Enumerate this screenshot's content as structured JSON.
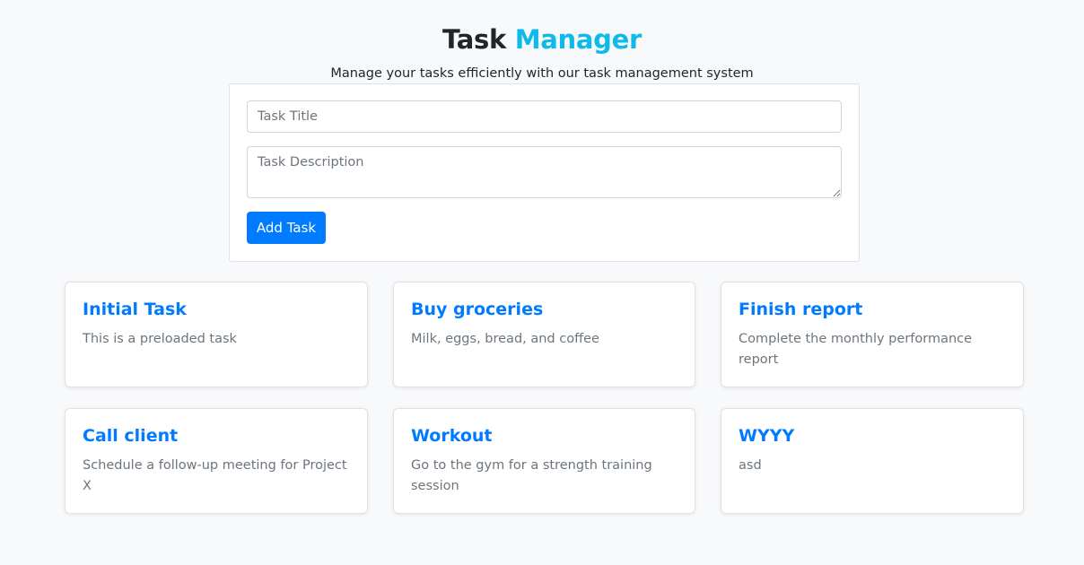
{
  "header": {
    "title_part1": "Task",
    "title_part2": "Manager",
    "subtitle": "Manage your tasks efficiently with our task management system"
  },
  "form": {
    "title_placeholder": "Task Title",
    "description_placeholder": "Task Description",
    "add_button_label": "Add Task"
  },
  "tasks": [
    {
      "title": "Initial Task",
      "description": "This is a preloaded task"
    },
    {
      "title": "Buy groceries",
      "description": "Milk, eggs, bread, and coffee"
    },
    {
      "title": "Finish report",
      "description": "Complete the monthly performance report"
    },
    {
      "title": "Call client",
      "description": "Schedule a follow-up meeting for Project X"
    },
    {
      "title": "Workout",
      "description": "Go to the gym for a strength training session"
    },
    {
      "title": "WYYY",
      "description": "asd"
    }
  ],
  "colors": {
    "accent": "#0fb9ea",
    "primary": "#007bff",
    "muted_text": "#6c757d",
    "background": "#f8f9fa"
  }
}
